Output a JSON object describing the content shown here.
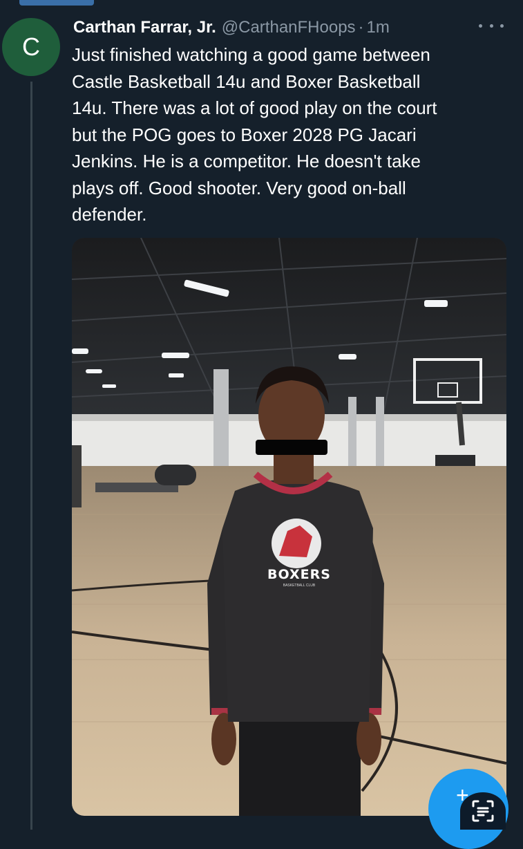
{
  "tweet": {
    "avatar_letter": "C",
    "author_name": "Carthan Farrar, Jr.",
    "handle": "@CarthanFHoops",
    "separator": "·",
    "time": "1m",
    "text_lines": [
      "Just finished watching a good game between",
      "Castle Basketball 14u and Boxer Basketball",
      "14u. There was a lot of good play on the court",
      "but the POG goes to Boxer 2028 PG Jacari",
      "Jenkins. He is a competitor.  He doesn't take",
      "plays off. Good shooter. Very good on-ball",
      "defender."
    ]
  },
  "media": {
    "jersey_text": "BOXERS",
    "jersey_subtext": "BASKETBALL CLUB"
  },
  "fab": {
    "symbol": "+"
  },
  "icons": {
    "more": "more-horizontal-icon",
    "scan": "scan-text-icon"
  },
  "colors": {
    "background": "#15202b",
    "text": "#ffffff",
    "secondary": "#8b98a5",
    "accent": "#1d9bf0"
  }
}
